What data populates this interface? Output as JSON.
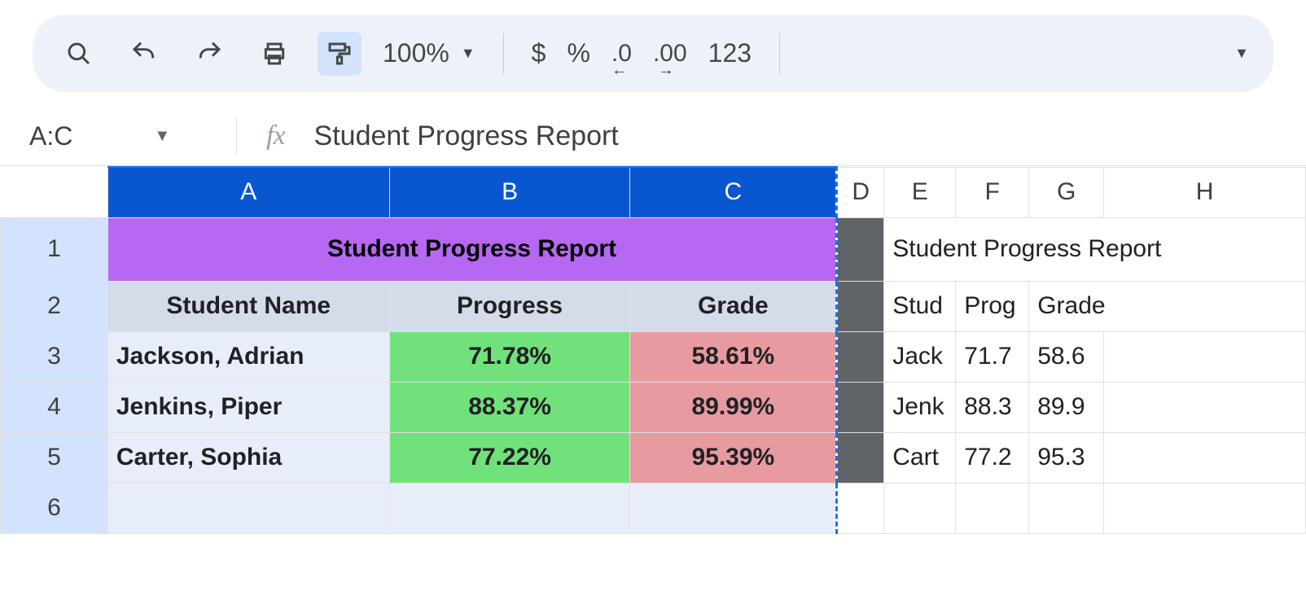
{
  "toolbar": {
    "zoom": "100%",
    "currency": "$",
    "percent": "%",
    "dec_dec": ".0",
    "inc_dec": ".00",
    "numfmt": "123"
  },
  "fbar": {
    "namebox": "A:C",
    "fx_label": "fx",
    "formula": "Student Progress Report"
  },
  "selected_cols": [
    "A",
    "B",
    "C"
  ],
  "other_cols": [
    "D",
    "E",
    "F",
    "G",
    "H"
  ],
  "row_numbers": [
    "1",
    "2",
    "3",
    "4",
    "5",
    "6"
  ],
  "sheet": {
    "title": "Student Progress Report",
    "headers": {
      "name": "Student Name",
      "progress": "Progress",
      "grade": "Grade"
    },
    "rows": [
      {
        "name": "Jackson, Adrian",
        "progress": "71.78%",
        "grade": "58.61%"
      },
      {
        "name": "Jenkins, Piper",
        "progress": "88.37%",
        "grade": "89.99%"
      },
      {
        "name": "Carter, Sophia",
        "progress": "77.22%",
        "grade": "95.39%"
      }
    ]
  },
  "side": {
    "title": "Student Progress Report",
    "hdr_name": "Stud",
    "hdr_prog": "Prog",
    "hdr_grade": "Grade",
    "rows": [
      {
        "e": "Jack",
        "f": "71.7",
        "g": "58.6"
      },
      {
        "e": "Jenk",
        "f": "88.3",
        "g": "89.9"
      },
      {
        "e": "Cart",
        "f": "77.2",
        "g": "95.3"
      }
    ]
  }
}
